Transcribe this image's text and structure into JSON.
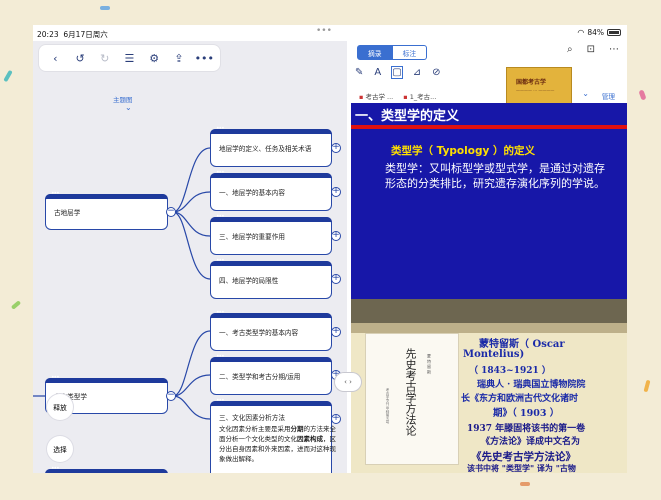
{
  "status": {
    "time": "20:23",
    "date": "6月17日周六",
    "dots": "•••",
    "battery": "84%"
  },
  "left_pane": {
    "toolbar": {
      "back": "‹",
      "undo": "↺",
      "redo": "↻",
      "outline": "☰",
      "style": "⚙",
      "export": "⇪",
      "more": "•••"
    },
    "theme_label": "主题图",
    "root1": "古地层学",
    "branches1": [
      "地层学的定义、任务及相关术语",
      "一、地层学的基本内容",
      "三、地层学的重要作用",
      "四、地层学的局限性"
    ],
    "root2": "考古类型学",
    "branches2": [
      "一、考古类型学的基本内容",
      "二、类型学和考古分期/运用",
      "三、文化因素分析方法"
    ],
    "desc": {
      "p1": "文化因素分析主要是采用",
      "b1": "分期",
      "p2": "的方法来全面分析一个文化类型的文化",
      "b2": "因素构成",
      "p3": "，区分出自身因素和外来因素，进而对这种现象做出解释。"
    },
    "float_labels": {
      "release": "释放",
      "select": "选择"
    },
    "divider": "‹ ›"
  },
  "right_pane": {
    "segments": [
      "摘录",
      "标注"
    ],
    "top_icons": {
      "search": "⌕",
      "bookmark": "⊡",
      "more": "⋯"
    },
    "tools": {
      "pen": "✎",
      "highlighter": "A",
      "select_box": "▢",
      "lasso": "⊿",
      "eraser": "⊘"
    },
    "tabs": [
      "考古学 ...",
      "1_考古..."
    ],
    "manage": "管理",
    "book": {
      "title": "国都考古学",
      "subtitle": "———— ··· ————"
    },
    "slide1": {
      "heading": "一、类型学的定义",
      "subheading": "类型学（ Typology ）的定义",
      "body": "类型学：又叫标型学或型式学，是通过对遗存形态的分类排比，研究遗存演化序列的学说。"
    },
    "slide2": {
      "cover_title": "先史考古学方法论",
      "cover_author": "蒙 特 留 斯",
      "cover_side": "考古学专刊 甲种第五号",
      "line1": "蒙特留斯（ Oscar",
      "line2": "Montelius)",
      "line3": "（ 1843~1921 ）",
      "line4": "瑞典人 · 瑞典国立博物院院",
      "line5": "长《东方和欧洲古代文化诸时",
      "line6": "期》（ 1903 ）",
      "line7": "1937 年滕固将该书的第一卷",
      "line8": "《方法论》译成中文名为",
      "line9": "《先史考古学方法论》",
      "line10": "该书中将 \"类型学\" 译为 \"古物"
    }
  }
}
